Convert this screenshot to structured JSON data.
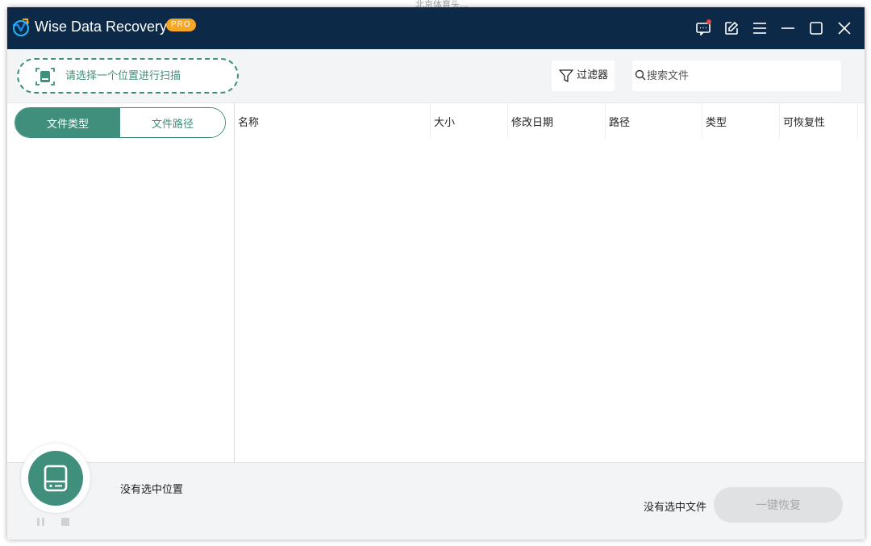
{
  "background": {
    "text": "北京体育头..."
  },
  "app": {
    "title": "Wise Data Recovery",
    "badge": "PRO"
  },
  "titlebar": {
    "icons": [
      "feedback-icon",
      "edit-icon",
      "menu-icon",
      "minimize-icon",
      "maximize-icon",
      "close-icon"
    ]
  },
  "toolbar": {
    "scan_select_label": "请选择一个位置进行扫描",
    "filter_label": "过滤器",
    "search_placeholder": "搜索文件",
    "search_value": ""
  },
  "sidebar": {
    "tabs": [
      {
        "label": "文件类型",
        "active": true
      },
      {
        "label": "文件路径",
        "active": false
      }
    ]
  },
  "table": {
    "columns": [
      "名称",
      "大小",
      "修改日期",
      "路径",
      "类型",
      "可恢复性"
    ],
    "rows": []
  },
  "status": {
    "location": "没有选中位置",
    "files": "没有选中文件",
    "recover_button": "一键恢复",
    "recover_enabled": false
  },
  "colors": {
    "titlebar": "#0c2a47",
    "accent": "#3f8f7c",
    "badge": "#f5a623",
    "notification": "#e8453c"
  }
}
